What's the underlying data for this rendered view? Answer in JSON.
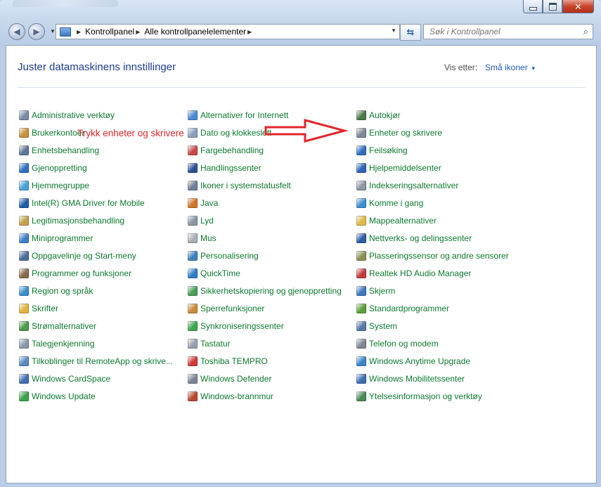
{
  "window": {
    "buttons": {
      "minimize": "minimize",
      "maximize": "maximize",
      "close": "close"
    }
  },
  "address": {
    "crumbs": [
      "Kontrollpanel",
      "Alle kontrollpanelelementer"
    ]
  },
  "search": {
    "placeholder": "Søk i Kontrollpanel"
  },
  "header": {
    "title": "Juster datamaskinens innstillinger",
    "view_label": "Vis etter:",
    "view_value": "Små ikoner"
  },
  "annotation": {
    "text": "Trykk enheter og skrivere",
    "color": "#e1262a"
  },
  "columns": [
    [
      {
        "label": "Administrative verktøy",
        "icon": "admin-tools-icon",
        "color": "#7b8aa3"
      },
      {
        "label": "Brukerkontoer",
        "icon": "user-accounts-icon",
        "color": "#c9913d"
      },
      {
        "label": "Enhetsbehandling",
        "icon": "device-manager-icon",
        "color": "#5d7896"
      },
      {
        "label": "Gjenoppretting",
        "icon": "recovery-icon",
        "color": "#2f6fc2"
      },
      {
        "label": "Hjemmegruppe",
        "icon": "homegroup-icon",
        "color": "#4aa3d8"
      },
      {
        "label": "Intel(R) GMA Driver for Mobile",
        "icon": "intel-icon",
        "color": "#1f5ca8"
      },
      {
        "label": "Legitimasjonsbehandling",
        "icon": "credential-manager-icon",
        "color": "#c4a24b"
      },
      {
        "label": "Miniprogrammer",
        "icon": "gadgets-icon",
        "color": "#3f7fc8"
      },
      {
        "label": "Oppgavelinje og Start-meny",
        "icon": "taskbar-icon",
        "color": "#4a6c99"
      },
      {
        "label": "Programmer og funksjoner",
        "icon": "programs-icon",
        "color": "#8a6a4a"
      },
      {
        "label": "Region og språk",
        "icon": "region-language-icon",
        "color": "#3b8fd0"
      },
      {
        "label": "Skrifter",
        "icon": "fonts-icon",
        "color": "#e0b33a"
      },
      {
        "label": "Strømalternativer",
        "icon": "power-options-icon",
        "color": "#4a9b4a"
      },
      {
        "label": "Talegjenkjenning",
        "icon": "speech-recognition-icon",
        "color": "#8c98a8"
      },
      {
        "label": "Tilkoblinger til RemoteApp og skrive...",
        "icon": "remoteapp-icon",
        "color": "#5c87c2"
      },
      {
        "label": "Windows CardSpace",
        "icon": "cardspace-icon",
        "color": "#3f6fb2"
      },
      {
        "label": "Windows Update",
        "icon": "windows-update-icon",
        "color": "#3aa04a"
      }
    ],
    [
      {
        "label": "Alternativer for Internett",
        "icon": "internet-options-icon",
        "color": "#4b8ad3"
      },
      {
        "label": "Dato og klokkeslett",
        "icon": "date-time-icon",
        "color": "#8aa0bd"
      },
      {
        "label": "Fargebehandling",
        "icon": "color-management-icon",
        "color": "#c94a4a"
      },
      {
        "label": "Handlingssenter",
        "icon": "action-center-icon",
        "color": "#2d4f94"
      },
      {
        "label": "Ikoner i systemstatusfelt",
        "icon": "notification-icons-icon",
        "color": "#6f7f95"
      },
      {
        "label": "Java",
        "icon": "java-icon",
        "color": "#d2752a"
      },
      {
        "label": "Lyd",
        "icon": "sound-icon",
        "color": "#8b95a5"
      },
      {
        "label": "Mus",
        "icon": "mouse-icon",
        "color": "#a9afb8"
      },
      {
        "label": "Personalisering",
        "icon": "personalization-icon",
        "color": "#3e7fbf"
      },
      {
        "label": "QuickTime",
        "icon": "quicktime-icon",
        "color": "#2f7dc6"
      },
      {
        "label": "Sikkerhetskopiering og gjenoppretting",
        "icon": "backup-icon",
        "color": "#4a9d52"
      },
      {
        "label": "Sperrefunksjoner",
        "icon": "parental-controls-icon",
        "color": "#c88a3a"
      },
      {
        "label": "Synkroniseringssenter",
        "icon": "sync-center-icon",
        "color": "#3ca74a"
      },
      {
        "label": "Tastatur",
        "icon": "keyboard-icon",
        "color": "#9aa2ad"
      },
      {
        "label": "Toshiba TEMPRO",
        "icon": "toshiba-tempro-icon",
        "color": "#d23a3a"
      },
      {
        "label": "Windows Defender",
        "icon": "windows-defender-icon",
        "color": "#7b8594"
      },
      {
        "label": "Windows-brannmur",
        "icon": "firewall-icon",
        "color": "#b8492f"
      }
    ],
    [
      {
        "label": "Autokjør",
        "icon": "autoplay-icon",
        "color": "#4a7a4a"
      },
      {
        "label": "Enheter og skrivere",
        "icon": "devices-printers-icon",
        "color": "#7d8796"
      },
      {
        "label": "Feilsøking",
        "icon": "troubleshooting-icon",
        "color": "#2f6fc2"
      },
      {
        "label": "Hjelpemiddelsenter",
        "icon": "ease-of-access-icon",
        "color": "#2e64b8"
      },
      {
        "label": "Indekseringsalternativer",
        "icon": "indexing-icon",
        "color": "#8d97a6"
      },
      {
        "label": "Komme i gang",
        "icon": "getting-started-icon",
        "color": "#3b8fd0"
      },
      {
        "label": "Mappealternativer",
        "icon": "folder-options-icon",
        "color": "#e3b84a"
      },
      {
        "label": "Nettverks- og delingssenter",
        "icon": "network-sharing-icon",
        "color": "#2f5ea8"
      },
      {
        "label": "Plasseringssensor og andre sensorer",
        "icon": "location-sensor-icon",
        "color": "#8b8f52"
      },
      {
        "label": "Realtek HD Audio Manager",
        "icon": "realtek-audio-icon",
        "color": "#c23b3b"
      },
      {
        "label": "Skjerm",
        "icon": "display-icon",
        "color": "#3c78c0"
      },
      {
        "label": "Standardprogrammer",
        "icon": "default-programs-icon",
        "color": "#5aa03a"
      },
      {
        "label": "System",
        "icon": "system-icon",
        "color": "#5678a8"
      },
      {
        "label": "Telefon og modem",
        "icon": "phone-modem-icon",
        "color": "#7e8792"
      },
      {
        "label": "Windows Anytime Upgrade",
        "icon": "anytime-upgrade-icon",
        "color": "#3a86c8"
      },
      {
        "label": "Windows Mobilitetssenter",
        "icon": "mobility-center-icon",
        "color": "#3f6fb2"
      },
      {
        "label": "Ytelsesinformasjon og verktøy",
        "icon": "performance-icon",
        "color": "#4a8a5a"
      }
    ]
  ]
}
